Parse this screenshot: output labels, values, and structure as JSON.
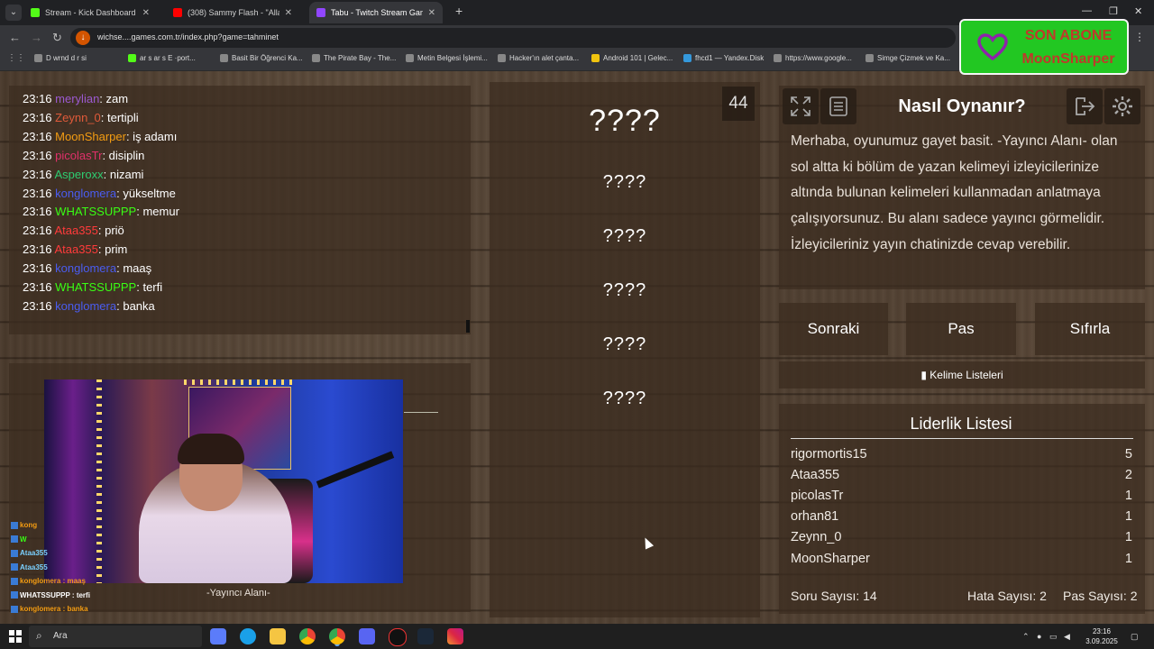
{
  "browser": {
    "tabs": [
      {
        "label": "Stream - Kick Dashboard",
        "color": "#53fc18"
      },
      {
        "label": "(308) Sammy Flash - \"Alla Yar\" (",
        "color": "#ff0000"
      },
      {
        "label": "Tabu - Twitch Stream Game",
        "color": "#9146ff"
      }
    ],
    "new_tab": "+",
    "url": "wichse....games.com.tr/index.php?game=tahminet",
    "bookmarks": [
      "D wrnd d r si",
      "ar s ar s E ·port...",
      "Basit Bir Öğrenci Ka...",
      "The Pirate Bay - The...",
      "Metin Belgesi İşlemi...",
      "Hacker'ın alet çanta...",
      "Android 101 | Gelec...",
      "fhcd1 — Yandex.Disk",
      "https://www.google...",
      "Simge Çizmek ve Ka..."
    ]
  },
  "sub_alert": {
    "line1": "SON ABONE",
    "line2": "MoonSharper",
    "heart_color": "#8e24aa"
  },
  "chat": [
    {
      "time": "23:16",
      "user": "merylian",
      "msg": ": zam",
      "color": "#9b59d0"
    },
    {
      "time": "23:16",
      "user": "Zeynn_0",
      "msg": ": tertipli",
      "color": "#e05a3a"
    },
    {
      "time": "23:16",
      "user": "MoonSharper",
      "msg": ": iş adamı",
      "color": "#f39c12"
    },
    {
      "time": "23:16",
      "user": "picolasTr",
      "msg": ": disiplin",
      "color": "#e0306a"
    },
    {
      "time": "23:16",
      "user": "Asperoxx",
      "msg": ": nizami",
      "color": "#2ecc71"
    },
    {
      "time": "23:16",
      "user": "konglomera",
      "msg": ": yükseltme",
      "color": "#4a5cf0"
    },
    {
      "time": "23:16",
      "user": "WHATSSUPPP",
      "msg": ": memur",
      "color": "#39ff14"
    },
    {
      "time": "23:16",
      "user": "Ataa355",
      "msg": ": priö",
      "color": "#ff3b3b"
    },
    {
      "time": "23:16",
      "user": "Ataa355",
      "msg": ": prim",
      "color": "#ff3b3b"
    },
    {
      "time": "23:16",
      "user": "konglomera",
      "msg": ": maaş",
      "color": "#4a5cf0"
    },
    {
      "time": "23:16",
      "user": "WHATSSUPPP",
      "msg": ": terfi",
      "color": "#39ff14"
    },
    {
      "time": "23:16",
      "user": "konglomera",
      "msg": ": banka",
      "color": "#4a5cf0"
    }
  ],
  "mini_chat": [
    {
      "text": "kong",
      "color": "#f39c12"
    },
    {
      "text": "W",
      "color": "#39ff14"
    },
    {
      "text": "Ataa355",
      "color": "#7ad0ff"
    },
    {
      "text": "Ataa355",
      "color": "#7ad0ff"
    },
    {
      "text": "konglomera : maaş",
      "color": "#f39c12"
    },
    {
      "text": "WHATSSUPPP : terfi",
      "color": "#ffffff"
    },
    {
      "text": "konglomera : banka",
      "color": "#f39c12"
    }
  ],
  "camera_label": "-Yayıncı Alanı-",
  "words": {
    "main": "????",
    "forbidden": [
      "????",
      "????",
      "????",
      "????",
      "????"
    ]
  },
  "timer": "44",
  "info": {
    "title": "Nasıl Oynanır?",
    "text": "Merhaba, oyunumuz gayet basit. -Yayıncı Alanı- olan sol altta ki bölüm de yazan kelimeyi izleyicilerinize altında bulunan kelimeleri kullanmadan anlatmaya çalışıyorsunuz. Bu alanı sadece yayıncı görmelidir. İzleyicileriniz yayın chatinizde cevap verebilir."
  },
  "buttons": {
    "next": "Sonraki",
    "pass": "Pas",
    "reset": "Sıfırla",
    "word_lists": "Kelime Listeleri"
  },
  "leaderboard": {
    "title": "Liderlik Listesi",
    "rows": [
      {
        "name": "rigormortis15",
        "points": "5"
      },
      {
        "name": "Ataa355",
        "points": "2"
      },
      {
        "name": "picolasTr",
        "points": "1"
      },
      {
        "name": "orhan81",
        "points": "1"
      },
      {
        "name": "Zeynn_0",
        "points": "1"
      },
      {
        "name": "MoonSharper",
        "points": "1"
      }
    ]
  },
  "stats": {
    "questions": "Soru Sayısı: 14",
    "errors": "Hata Sayısı: 2",
    "passes": "Pas Sayısı: 2"
  },
  "taskbar": {
    "search_placeholder": "Ara",
    "time": "23:16",
    "date": "3.09.2025"
  }
}
